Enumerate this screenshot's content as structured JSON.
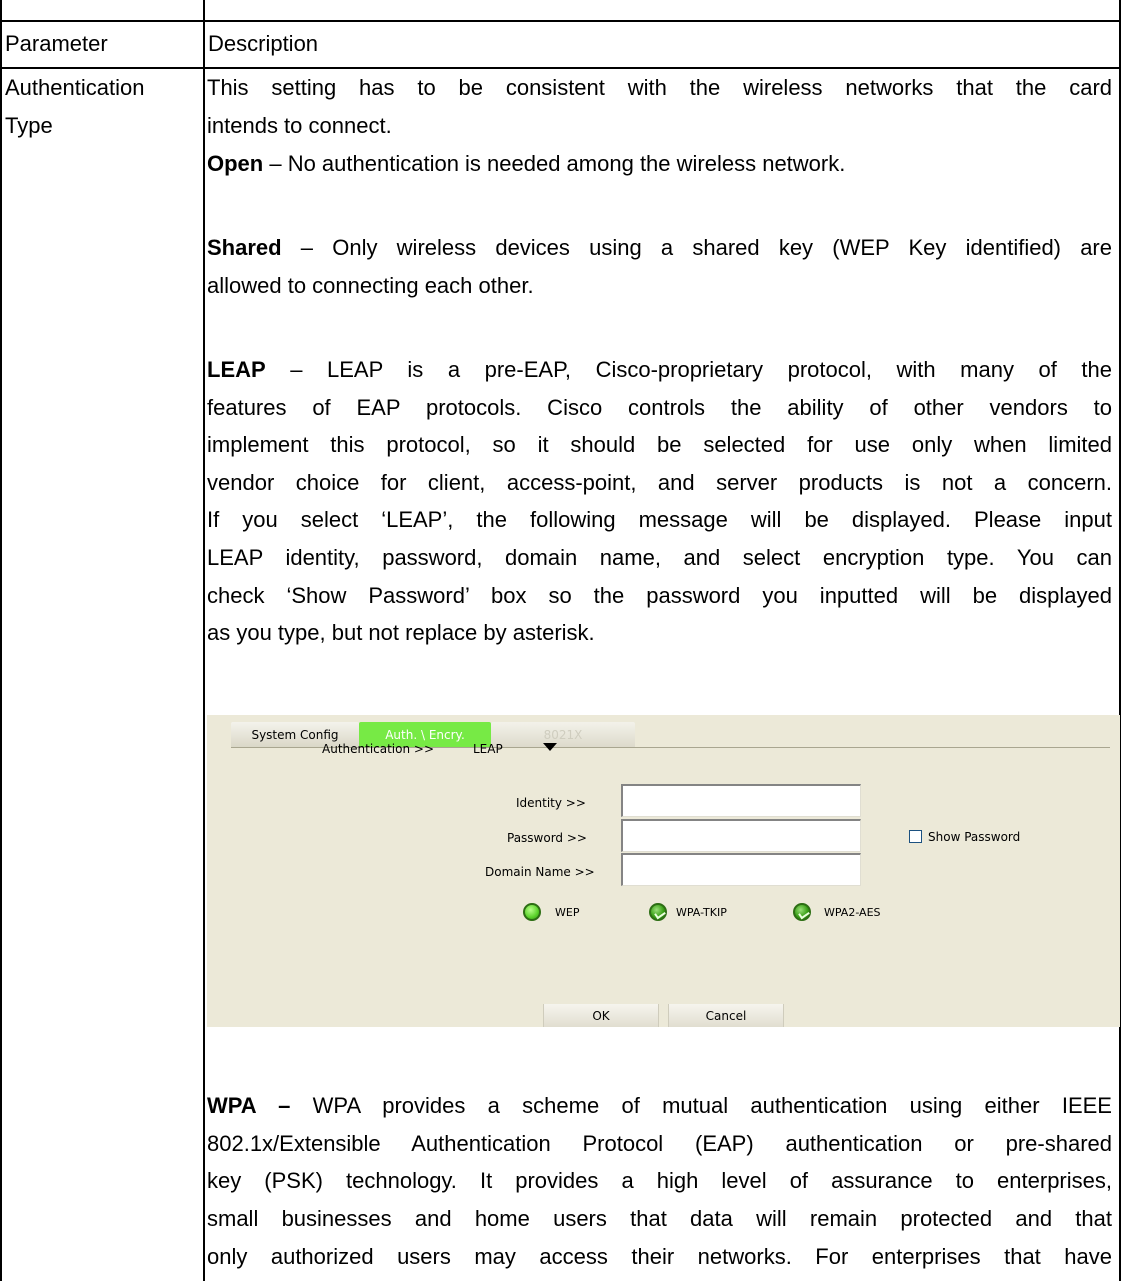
{
  "table": {
    "header": {
      "param": "Parameter",
      "desc": "Description"
    },
    "param_lines": [
      "Authentication",
      "Type"
    ],
    "intro_lines": [
      "This setting has to be consistent with the wireless networks that the card",
      "intends to connect."
    ],
    "open": {
      "term": "Open",
      "text": " – No authentication is needed among the wireless network."
    },
    "shared": {
      "term": "Shared",
      "line1": " – Only wireless devices using a shared key (WEP Key identified) are",
      "line2": "allowed to connecting each other."
    },
    "leap": {
      "term": "LEAP",
      "line1": " – LEAP is a pre-EAP, Cisco-proprietary protocol, with many of the",
      "lines": [
        "features of EAP protocols. Cisco controls the ability of other vendors to",
        "implement this protocol, so it should be selected for use only when limited",
        "vendor choice for client, access-point, and server products is not a concern.",
        "If you select ‘LEAP’, the following message will be displayed. Please input",
        "LEAP identity, password, domain name, and select encryption type. You can",
        "check ‘Show Password’ box so the password you inputted will be displayed",
        "as you type, but not replace by asterisk."
      ]
    },
    "wpa": {
      "term": "WPA –",
      "line1": " WPA provides a scheme of mutual authentication using either IEEE",
      "lines": [
        "802.1x/Extensible Authentication Protocol (EAP) authentication or pre-shared",
        "key (PSK) technology. It provides a high level of assurance to enterprises,",
        "small businesses and home users that data will remain protected and that",
        "only authorized users may access their networks. For enterprises that have"
      ]
    }
  },
  "screenshot": {
    "tabs": [
      "System Config",
      "Auth. \\ Encry.",
      "8021X"
    ],
    "active_tab": "Auth. \\ Encry.",
    "authentication_label": "Authentication >>",
    "authentication_value": "LEAP",
    "identity_label": "Identity >>",
    "password_label": "Password >>",
    "domain_label": "Domain Name >>",
    "show_password_label": "Show Password",
    "show_password_checked": false,
    "encryption_options": [
      "WEP",
      "WPA-TKIP",
      "WPA2-AES"
    ],
    "encryption_selected": "WEP",
    "ok_label": "OK",
    "cancel_label": "Cancel",
    "colors": {
      "panel": "#ece9d8",
      "active_tab": "#77ea45"
    }
  }
}
